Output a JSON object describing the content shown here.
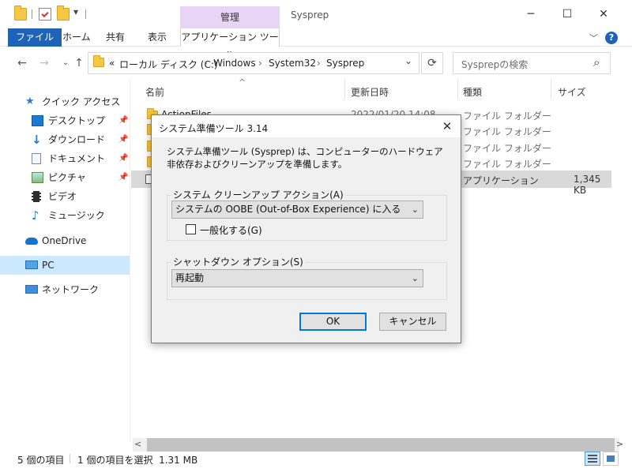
{
  "window": {
    "title": "Sysprep",
    "contextual_tab_header": "管理",
    "minimize_glyph": "─",
    "maximize_glyph": "☐",
    "close_glyph": "✕"
  },
  "quick_access_toolbar": {
    "dropdown_glyph": "▾"
  },
  "ribbon": {
    "tabs": [
      "ファイル",
      "ホーム",
      "共有",
      "表示",
      "アプリケーション ツール"
    ],
    "collapse_glyph": "﹀",
    "help_glyph": "?"
  },
  "address_bar": {
    "back_glyph": "←",
    "forward_glyph": "→",
    "up_glyph": "↑",
    "overflow": "«",
    "crumbs": [
      "ローカル ディスク (C:)",
      "Windows",
      "System32",
      "Sysprep"
    ],
    "separator": "›",
    "dropdown_glyph": "⌄",
    "refresh_glyph": "⟳",
    "search_placeholder": "Sysprepの検索",
    "search_glyph": "⌕"
  },
  "sidebar": {
    "pin_glyph": "📌",
    "items": [
      {
        "label": "クイック アクセス",
        "icon": "star-icon"
      },
      {
        "label": "デスクトップ",
        "icon": "desktop-icon",
        "pinned": true
      },
      {
        "label": "ダウンロード",
        "icon": "download-icon",
        "pinned": true
      },
      {
        "label": "ドキュメント",
        "icon": "document-icon",
        "pinned": true
      },
      {
        "label": "ピクチャ",
        "icon": "picture-icon",
        "pinned": true
      },
      {
        "label": "ビデオ",
        "icon": "video-icon"
      },
      {
        "label": "ミュージック",
        "icon": "music-icon"
      },
      {
        "label": "OneDrive",
        "icon": "cloud-icon"
      },
      {
        "label": "PC",
        "icon": "pc-icon",
        "selected": true
      },
      {
        "label": "ネットワーク",
        "icon": "network-icon"
      }
    ]
  },
  "file_list": {
    "sort_glyph": "^",
    "columns": [
      "名前",
      "更新日時",
      "種類",
      "サイズ"
    ],
    "rows": [
      {
        "name": "ActionFiles",
        "modified": "2022/01/20 14:08",
        "type": "ファイル フォルダー",
        "size": ""
      },
      {
        "name": "",
        "modified": "",
        "type": "ファイル フォルダー",
        "size": ""
      },
      {
        "name": "",
        "modified": "",
        "type": "ファイル フォルダー",
        "size": ""
      },
      {
        "name": "",
        "modified": "",
        "type": "ファイル フォルダー",
        "size": ""
      },
      {
        "name": "",
        "modified": "",
        "type": "アプリケーション",
        "size": "1,345 KB",
        "selected": true
      }
    ],
    "scroll_left_glyph": "<",
    "scroll_right_glyph": ">"
  },
  "status_bar": {
    "item_count": "5 個の項目",
    "selection": "1 個の項目を選択  1.31 MB"
  },
  "dialog": {
    "title": "システム準備ツール 3.14",
    "close_glyph": "✕",
    "description": "システム準備ツール (Sysprep) は、コンピューターのハードウェア非依存およびクリーンアップを準備します。",
    "cleanup_group_label": "システム クリーンアップ アクション(A)",
    "cleanup_selected": "システムの OOBE (Out-of-Box Experience) に入る",
    "generalize_label": "一般化する(G)",
    "generalize_checked": false,
    "shutdown_group_label": "シャットダウン オプション(S)",
    "shutdown_selected": "再起動",
    "combo_arrow_glyph": "⌄",
    "ok_label": "OK",
    "cancel_label": "キャンセル"
  },
  "colors": {
    "accent": "#1f63b8",
    "contextual_tab": "#e8d4f5",
    "selection": "#cce8ff",
    "folder": "#f6c744",
    "default_button_border": "#0078d7"
  }
}
